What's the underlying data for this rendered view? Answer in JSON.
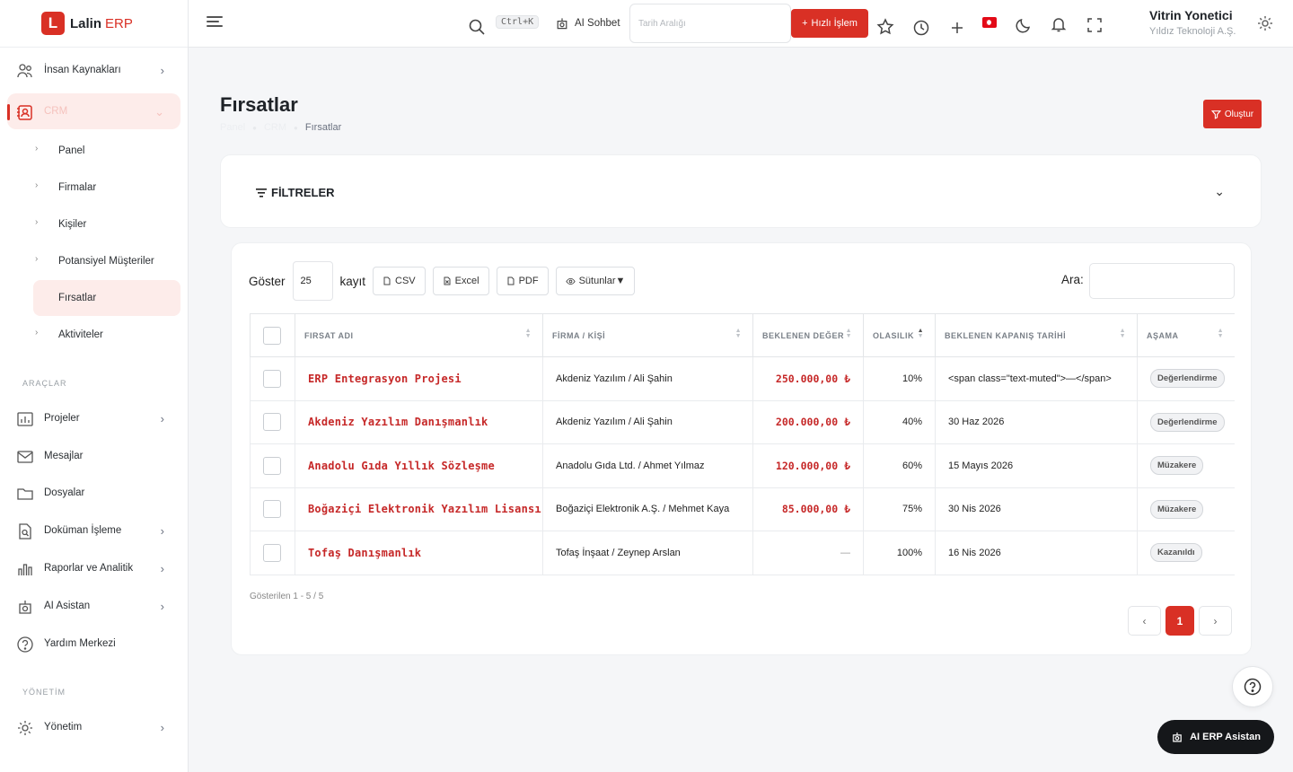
{
  "brand": {
    "logo_letter": "L",
    "name": "Lalin",
    "suffix": "ERP"
  },
  "sidebar": {
    "items": [
      {
        "label": "İnsan Kaynakları",
        "icon": "people-icon"
      },
      {
        "label": "CRM",
        "icon": "contacts-icon"
      },
      {
        "label": "Projeler",
        "icon": "chart-icon"
      },
      {
        "label": "Mesajlar",
        "icon": "mail-icon"
      },
      {
        "label": "Dosyalar",
        "icon": "folder-icon"
      },
      {
        "label": "Doküman İşleme",
        "icon": "document-scan-icon"
      },
      {
        "label": "Raporlar ve Analitik",
        "icon": "bar-chart-icon"
      },
      {
        "label": "AI Asistan",
        "icon": "robot-icon"
      },
      {
        "label": "Yardım Merkezi",
        "icon": "help-icon"
      },
      {
        "label": "Yönetim",
        "icon": "gear-icon"
      }
    ],
    "crm_sub": [
      "Panel",
      "Firmalar",
      "Kişiler",
      "Potansiyel Müşteriler",
      "Fırsatlar",
      "Aktiviteler"
    ],
    "sections": {
      "tools": "ARAÇLAR",
      "admin": "YÖNETİM"
    }
  },
  "header": {
    "shortcut": "Ctrl+K",
    "ai_chat": "AI Sohbet",
    "date_placeholder": "Tarih Aralığı",
    "quick_action": "Hızlı İşlem",
    "user_name": "Vitrin Yonetici",
    "user_company": "Yıldız Teknoloji A.Ş."
  },
  "page": {
    "title": "Fırsatlar",
    "breadcrumb": [
      "Panel",
      "CRM",
      "Fırsatlar"
    ],
    "create_label": "Oluştur"
  },
  "filters": {
    "title": "FİLTRELER"
  },
  "table_toolbar": {
    "show_label": "Göster",
    "page_size": "25",
    "records_label": "kayıt",
    "csv": "CSV",
    "excel": "Excel",
    "pdf": "PDF",
    "columns": "Sütunlar▼",
    "search_label": "Ara:"
  },
  "table": {
    "columns": [
      "FIRSAT ADI",
      "FİRMA / KİŞİ",
      "BEKLENEN DEĞER",
      "OLASILIK",
      "BEKLENEN KAPANIŞ TARİHİ",
      "AŞAMA"
    ],
    "rows": [
      {
        "name": "ERP Entegrasyon Projesi",
        "company": "Akdeniz Yazılım / Ali Şahin",
        "value": "250.000,00 ₺",
        "probability": "10%",
        "close_date": "<span class=\"text-muted\">—</span>",
        "stage": "Değerlendirme"
      },
      {
        "name": "Akdeniz Yazılım Danışmanlık",
        "company": "Akdeniz Yazılım / Ali Şahin",
        "value": "200.000,00 ₺",
        "probability": "40%",
        "close_date": "30 Haz 2026",
        "stage": "Değerlendirme"
      },
      {
        "name": "Anadolu Gıda Yıllık Sözleşme",
        "company": "Anadolu Gıda Ltd. / Ahmet Yılmaz",
        "value": "120.000,00 ₺",
        "probability": "60%",
        "close_date": "15 Mayıs 2026",
        "stage": "Müzakere"
      },
      {
        "name": "Boğaziçi Elektronik Yazılım Lisansı",
        "company": "Boğaziçi Elektronik A.Ş. / Mehmet Kaya",
        "value": "85.000,00 ₺",
        "probability": "75%",
        "close_date": "30 Nis 2026",
        "stage": "Müzakere"
      },
      {
        "name": "Tofaş Danışmanlık",
        "company": "Tofaş İnşaat / Zeynep Arslan",
        "value": "—",
        "probability": "100%",
        "close_date": "16 Nis 2026",
        "stage": "Kazanıldı"
      }
    ],
    "showing": "Gösterilen 1 - 5 / 5",
    "current_page": "1"
  },
  "fab": {
    "ai_erp": "AI ERP Asistan"
  },
  "colors": {
    "accent": "#d93025",
    "accent_soft": "#fdecea"
  }
}
